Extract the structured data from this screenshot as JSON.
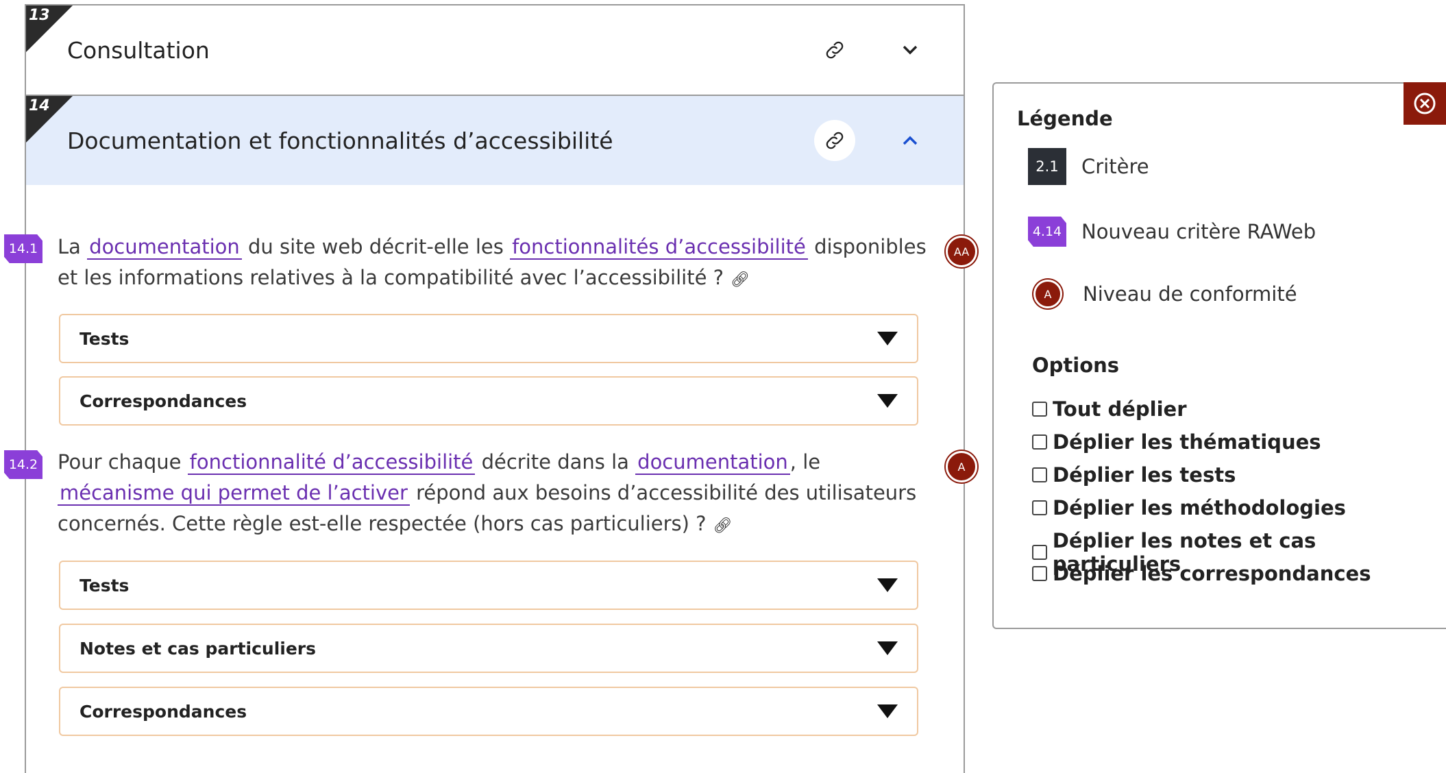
{
  "themes": [
    {
      "number": "13",
      "title": "Consultation",
      "expanded": false
    },
    {
      "number": "14",
      "title": "Documentation et fonctionnalités d’accessibilité",
      "expanded": true
    }
  ],
  "criteria": [
    {
      "number": "14.1",
      "level": "AA",
      "text_parts": [
        "La ",
        "documentation",
        " du site web décrit-elle les ",
        "fonctionnalités d’accessibilité",
        " disponibles et les informations relatives à la compatibilité avec l’accessibilité ?"
      ],
      "accordions": [
        "Tests",
        "Correspondances"
      ]
    },
    {
      "number": "14.2",
      "level": "A",
      "text_parts": [
        "Pour chaque ",
        "fonctionnalité d’accessibilité",
        " décrite dans la ",
        "documentation",
        ", le ",
        "mécanisme qui permet de l’activer",
        " répond aux besoins d’accessibilité des utilisateurs concernés. Cette règle est-elle respectée (hors cas particuliers) ?"
      ],
      "accordions": [
        "Tests",
        "Notes et cas particuliers",
        "Correspondances"
      ]
    }
  ],
  "legend": {
    "title": "Légende",
    "items": [
      {
        "badge": "2.1",
        "label": "Critère"
      },
      {
        "badge": "4.14",
        "label": "Nouveau critère RAWeb"
      },
      {
        "badge": "A",
        "label": "Niveau de conformité"
      }
    ],
    "options_title": "Options",
    "options": [
      "Tout déplier",
      "Déplier les thématiques",
      "Déplier les tests",
      "Déplier les méthodologies",
      "Déplier les notes et cas particuliers",
      "Déplier les correspondances"
    ]
  },
  "icons": {
    "link": "link-icon",
    "chevron_down": "chevron-down-icon",
    "chevron_up": "chevron-up-icon",
    "caret_down": "caret-down-icon",
    "close": "close-icon"
  },
  "colors": {
    "new_criterion_badge": "#8b3fd8",
    "level_badge": "#8b1a0b",
    "expanded_theme_bg": "#e3ecfb",
    "accordion_border": "#f0c8a0",
    "link": "#6a2fb0"
  }
}
